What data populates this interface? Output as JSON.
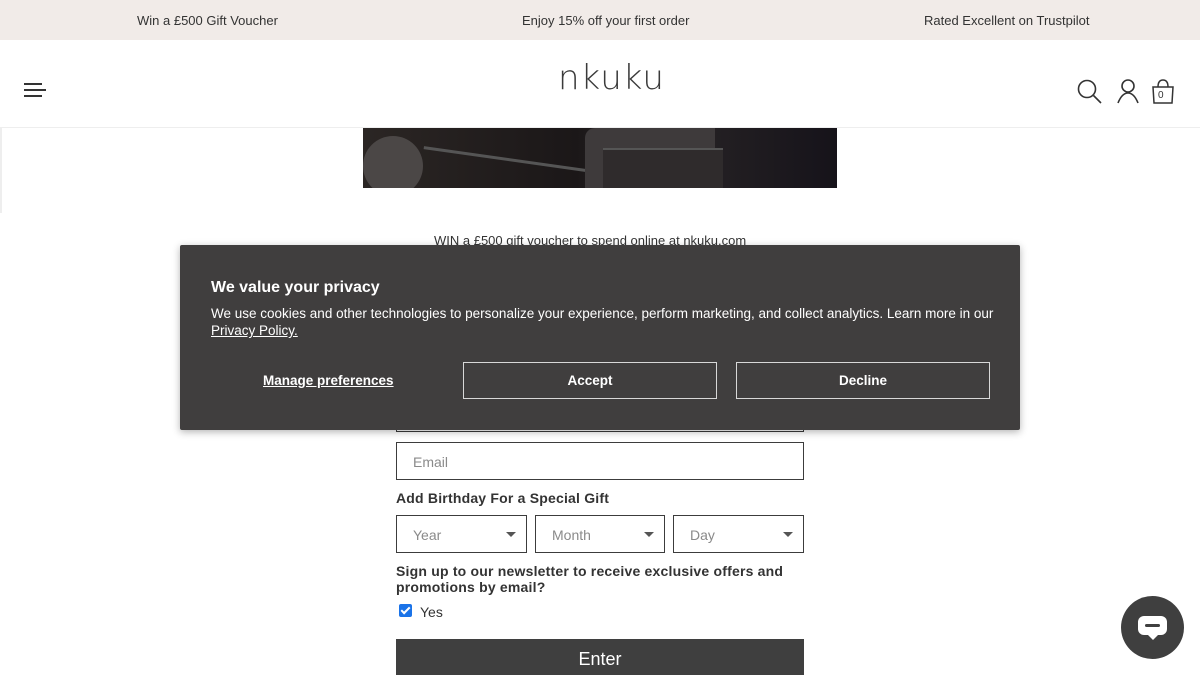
{
  "announcement": {
    "item1": "Win a £500 Gift Voucher",
    "item2": "Enjoy 15% off your first order",
    "item3": "Rated Excellent on Trustpilot"
  },
  "header": {
    "logo": "nkuku",
    "cart_count": "0",
    "icons": [
      "menu-icon",
      "search-icon",
      "account-icon",
      "cart-icon"
    ]
  },
  "promo": {
    "text": "WIN a £500 gift voucher to spend online at nkuku.com"
  },
  "form": {
    "email_placeholder": "Email",
    "birthday_label": "Add Birthday For a Special Gift",
    "year_placeholder": "Year",
    "month_placeholder": "Month",
    "day_placeholder": "Day",
    "newsletter_question": "Sign up to our newsletter to receive exclusive offers and promotions by email?",
    "newsletter_checked": true,
    "newsletter_option": "Yes",
    "submit_label": "Enter"
  },
  "cookie_banner": {
    "title": "We value your privacy",
    "body": "We use cookies and other technologies to personalize your experience, perform marketing, and collect analytics. Learn more in our ",
    "policy_link": "Privacy Policy.",
    "manage_label": "Manage preferences",
    "accept_label": "Accept",
    "decline_label": "Decline",
    "background": "#403e3e"
  },
  "chat": {
    "icon": "chat-icon",
    "color": "#3f3f3f"
  }
}
